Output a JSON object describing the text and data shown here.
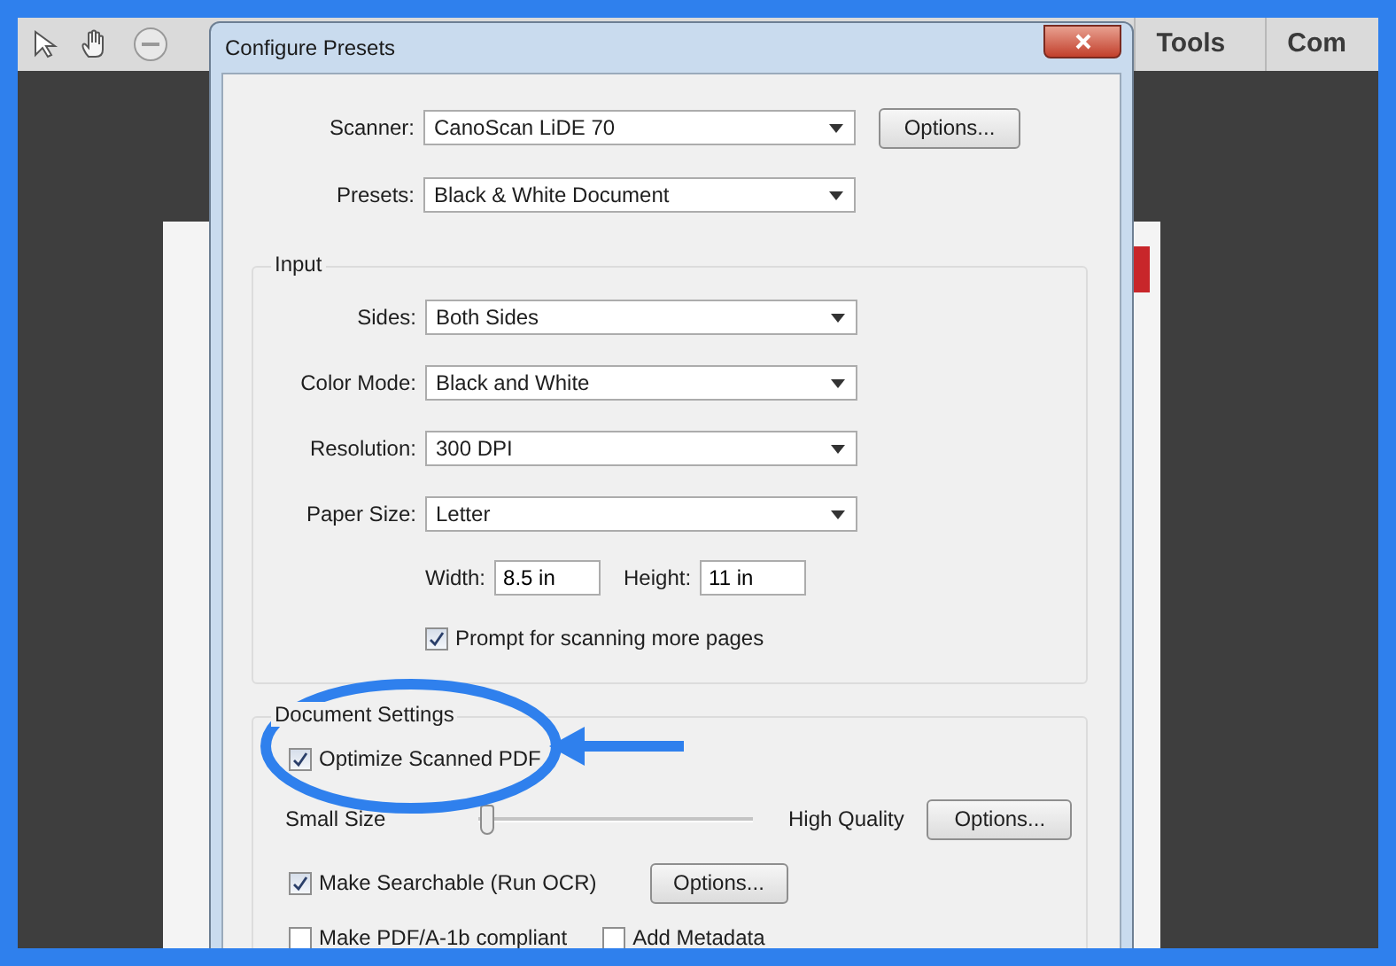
{
  "app_toolbar": {
    "tabs": [
      "Tools",
      "Com"
    ]
  },
  "dialog": {
    "title": "Configure Presets",
    "scanner": {
      "label": "Scanner:",
      "value": "CanoScan LiDE 70",
      "button": "Options..."
    },
    "presets": {
      "label": "Presets:",
      "value": "Black & White Document"
    },
    "input": {
      "title": "Input",
      "fields": [
        {
          "label": "Sides:",
          "value": "Both Sides"
        },
        {
          "label": "Color Mode:",
          "value": "Black and White"
        },
        {
          "label": "Resolution:",
          "value": "300 DPI"
        },
        {
          "label": "Paper Size:",
          "value": "Letter"
        }
      ],
      "width": {
        "label": "Width:",
        "value": "8.5 in"
      },
      "height": {
        "label": "Height:",
        "value": "11 in"
      },
      "prompt": {
        "label": "Prompt for scanning more pages",
        "checked": true
      }
    },
    "document_settings": {
      "title": "Document Settings",
      "optimize": {
        "label": "Optimize Scanned PDF",
        "checked": true
      },
      "slider": {
        "min_label": "Small Size",
        "max_label": "High Quality",
        "level": 0.02,
        "button": "Options..."
      },
      "searchable": {
        "label": "Make Searchable (Run OCR)",
        "checked": true,
        "button": "Options..."
      },
      "pdfa": {
        "label": "Make PDF/A-1b compliant",
        "checked": false
      },
      "metadata": {
        "label": "Add Metadata",
        "checked": false
      }
    }
  }
}
